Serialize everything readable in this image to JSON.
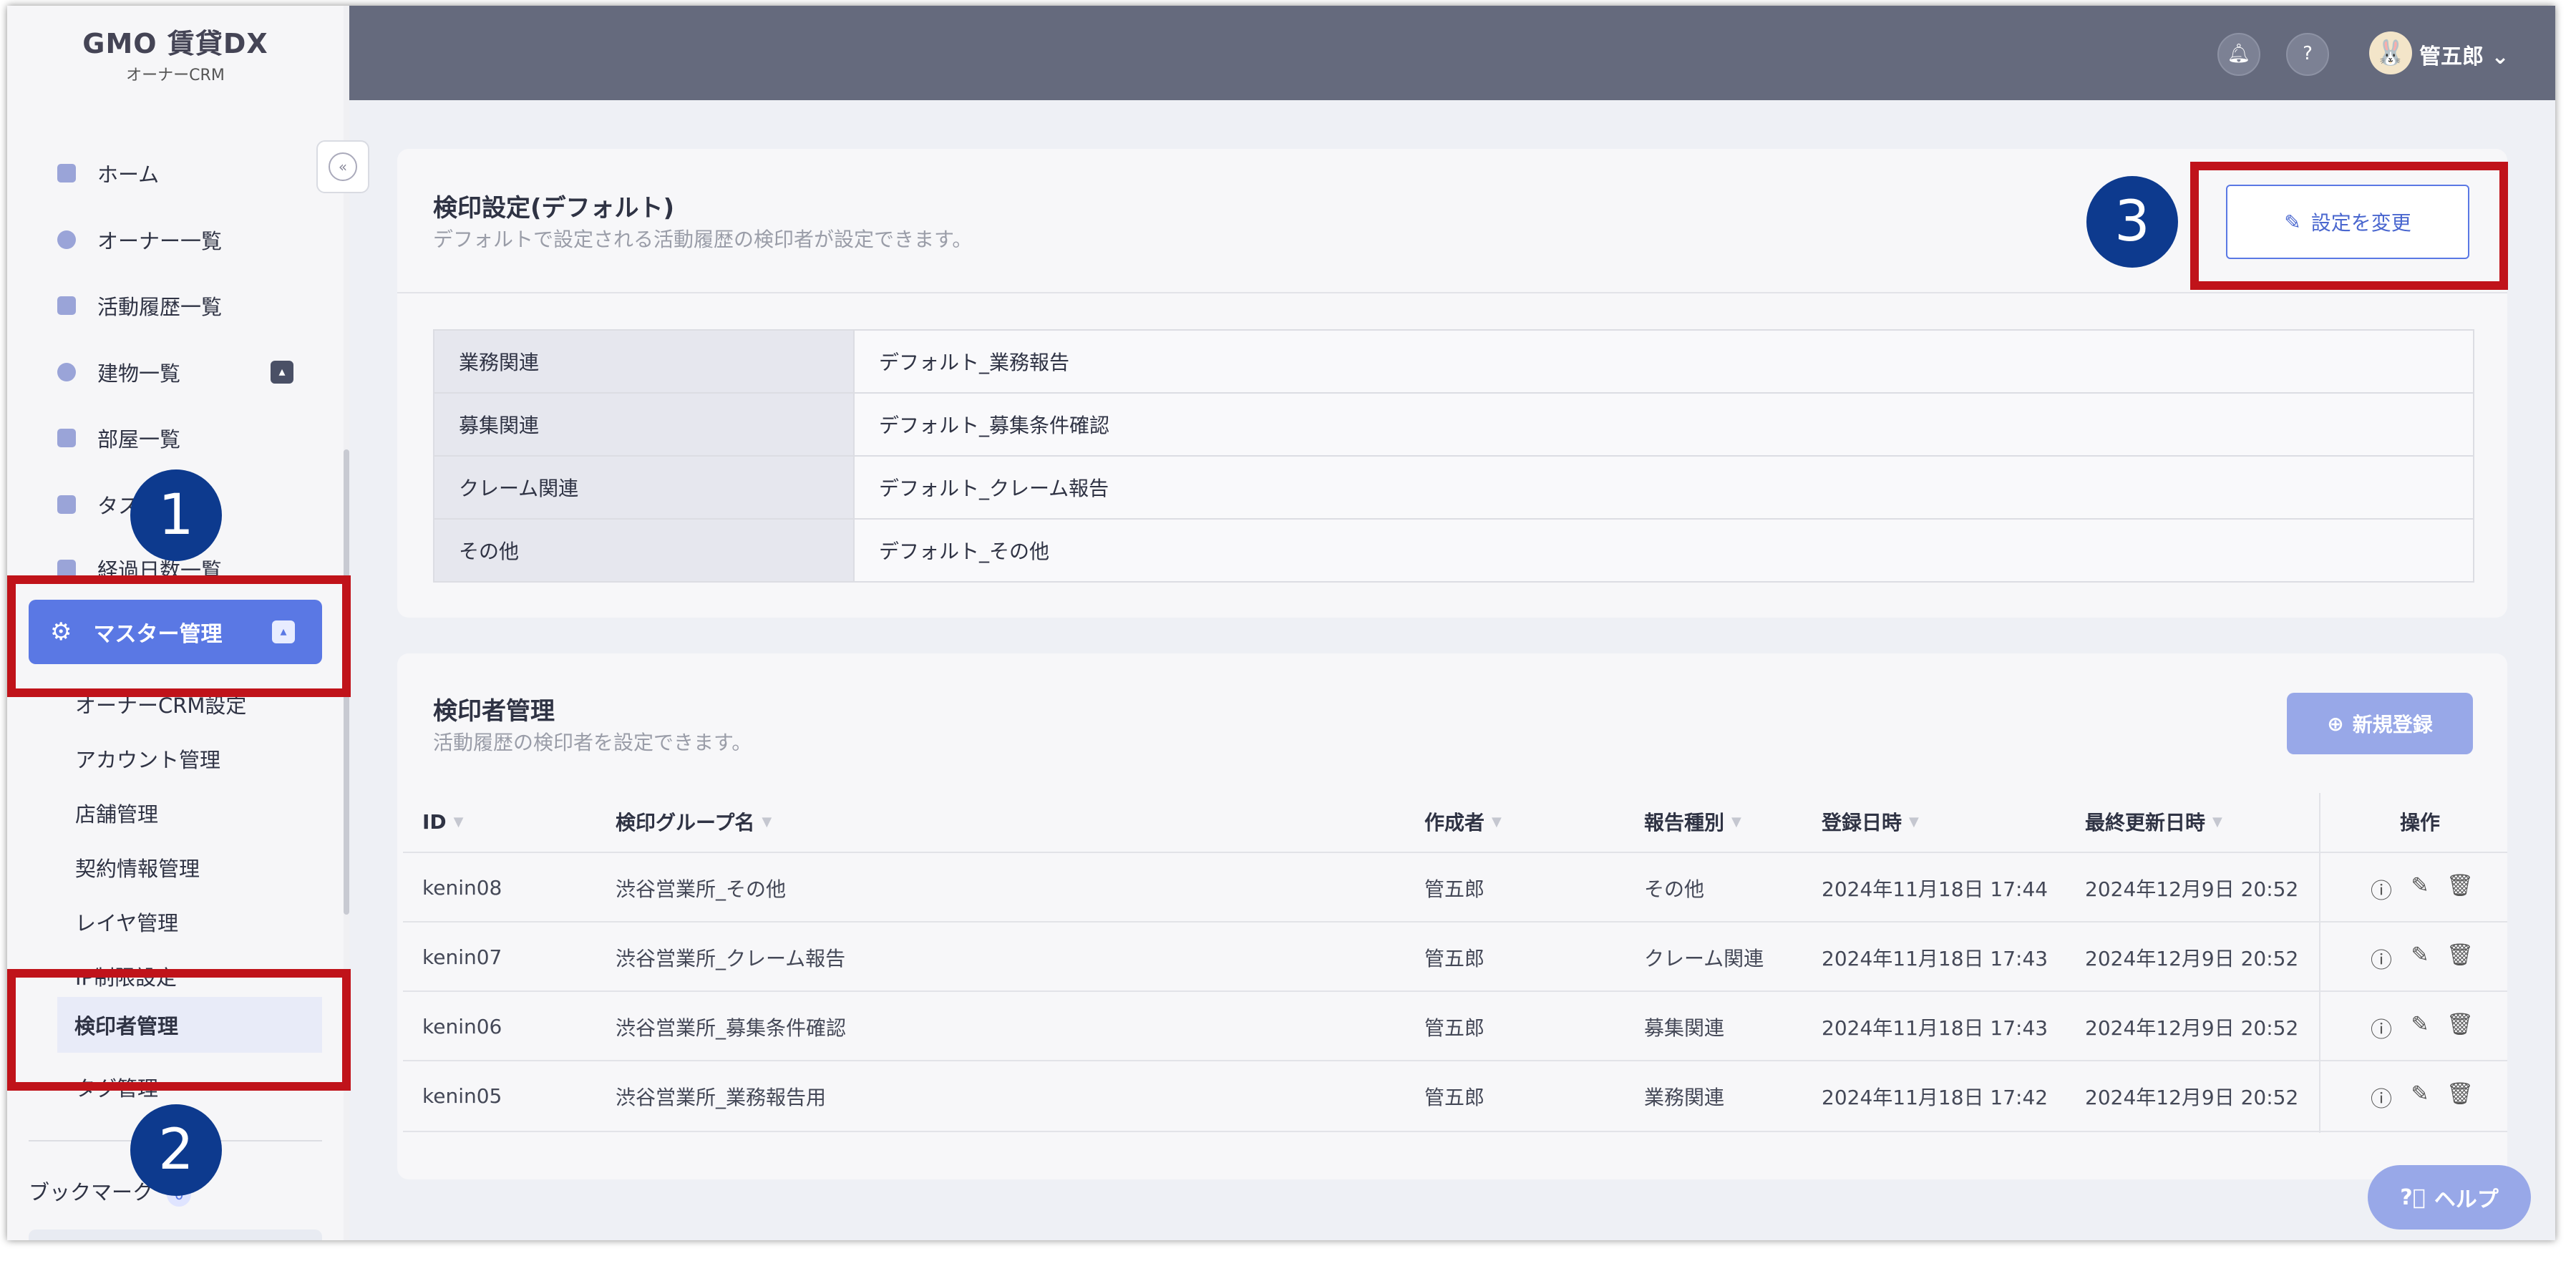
{
  "app": {
    "logo_main": "GMO 賃貸DX",
    "logo_sub": "オーナーCRM"
  },
  "header": {
    "username": "管五郎",
    "icons": [
      "bell-icon",
      "help-icon"
    ]
  },
  "sidebar": {
    "items": [
      {
        "label": "ホーム"
      },
      {
        "label": "オーナー一覧"
      },
      {
        "label": "活動履歴一覧"
      },
      {
        "label": "建物一覧"
      },
      {
        "label": "部屋一覧"
      },
      {
        "label": "タスク"
      },
      {
        "label": "経過日数一覧"
      }
    ],
    "active": "マスター管理",
    "subitems": [
      "オーナーCRM設定",
      "アカウント管理",
      "店舗管理",
      "契約情報管理",
      "レイヤ管理",
      "IP制限設定",
      "検印者管理",
      "タグ管理"
    ],
    "selected_sub": "検印者管理",
    "bookmark_label": "ブックマーク",
    "bookmark_count": "0"
  },
  "default_settings": {
    "title": "検印設定(デフォルト)",
    "description": "デフォルトで設定される活動履歴の検印者が設定できます。",
    "change_button": "設定を変更",
    "rows": [
      {
        "key": "業務関連",
        "value": "デフォルト_業務報告"
      },
      {
        "key": "募集関連",
        "value": "デフォルト_募集条件確認"
      },
      {
        "key": "クレーム関連",
        "value": "デフォルト_クレーム報告"
      },
      {
        "key": "その他",
        "value": "デフォルト_その他"
      }
    ]
  },
  "inspector": {
    "title": "検印者管理",
    "description": "活動履歴の検印者を設定できます。",
    "new_button": "新規登録",
    "columns": [
      "ID",
      "検印グループ名",
      "作成者",
      "報告種別",
      "登録日時",
      "最終更新日時",
      "操作"
    ],
    "rows": [
      {
        "id": "kenin08",
        "group": "渋谷営業所_その他",
        "creator": "管五郎",
        "type": "その他",
        "created": "2024年11月18日 17:44",
        "updated": "2024年12月9日 20:52"
      },
      {
        "id": "kenin07",
        "group": "渋谷営業所_クレーム報告",
        "creator": "管五郎",
        "type": "クレーム関連",
        "created": "2024年11月18日 17:43",
        "updated": "2024年12月9日 20:52"
      },
      {
        "id": "kenin06",
        "group": "渋谷営業所_募集条件確認",
        "creator": "管五郎",
        "type": "募集関連",
        "created": "2024年11月18日 17:43",
        "updated": "2024年12月9日 20:52"
      },
      {
        "id": "kenin05",
        "group": "渋谷営業所_業務報告用",
        "creator": "管五郎",
        "type": "業務関連",
        "created": "2024年11月18日 17:42",
        "updated": "2024年12月9日 20:52"
      }
    ]
  },
  "annotations": [
    "1",
    "2",
    "3"
  ],
  "help_label": "ヘルプ",
  "colors": {
    "accent": "#5a78e4",
    "annotation_red": "#c0131a",
    "annotation_blue": "#0d3a8e",
    "topbar": "#656a7d"
  }
}
